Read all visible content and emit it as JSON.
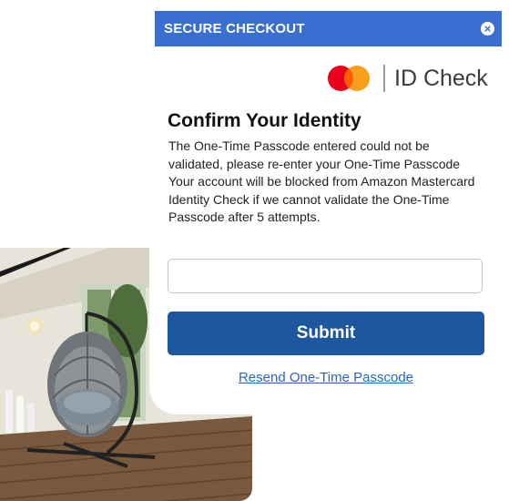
{
  "modal": {
    "title": "SECURE CHECKOUT",
    "close_glyph": "×",
    "close_icon": "close-icon"
  },
  "brand": {
    "logo_icon": "mastercard-logo",
    "name": "ID Check",
    "colors": {
      "red": "#eb001b",
      "orange": "#f79e1b",
      "overlap": "#ff5f00"
    }
  },
  "content": {
    "heading": "Confirm Your Identity",
    "message_line1": "The One-Time Passcode entered could not be validated, please re-enter your One-Time Passcode",
    "message_line2": "Your account will be blocked from Amazon Mastercard Identity Check if we cannot validate the One-Time Passcode after 5 attempts."
  },
  "form": {
    "passcode_value": "",
    "passcode_placeholder": "",
    "submit_label": "Submit",
    "resend_label": "Resend One-Time Passcode"
  },
  "colors": {
    "header_bg": "#3b6fcf",
    "submit_bg": "#1d579d",
    "link": "#2a63c9"
  }
}
